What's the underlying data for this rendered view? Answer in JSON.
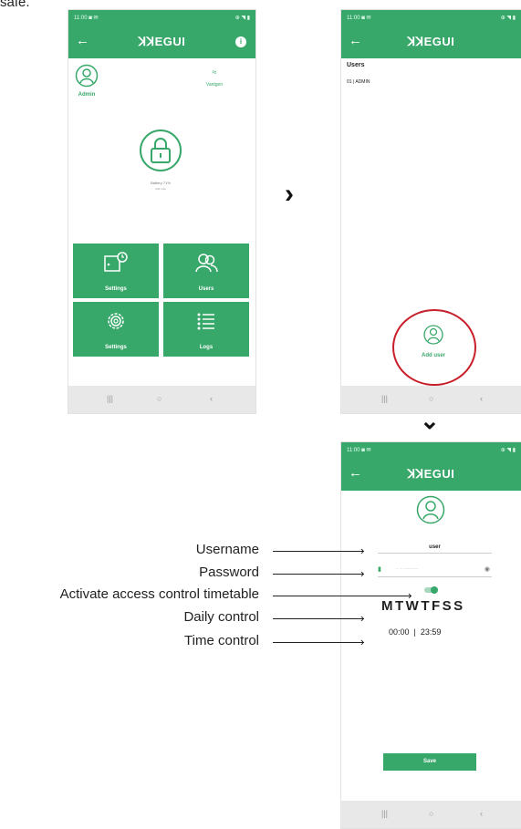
{
  "intro_text": "safe.",
  "colors": {
    "accent": "#38a86a",
    "annotation_circle": "#c8202a"
  },
  "phone1": {
    "status_left": "11:00 ◙ ✉",
    "status_right": "⊕ ◥ ▮",
    "app_title": "ꓘꓘEGUI",
    "info_badge": "i",
    "user_label": "Admin",
    "wifi_label": "Vantgen",
    "lock_caption": "Battery 71%",
    "lock_sub": "Add note",
    "tiles": [
      {
        "label": "Settings",
        "icon": "door-clock-icon"
      },
      {
        "label": "Users",
        "icon": "users-icon"
      },
      {
        "label": "Settings",
        "icon": "gear-icon"
      },
      {
        "label": "Logs",
        "icon": "list-icon"
      }
    ],
    "nav": [
      "|||",
      "○",
      "‹"
    ]
  },
  "phone2": {
    "status_left": "11:00 ◙ ✉",
    "status_right": "⊕ ◥ ▮",
    "app_title": "ꓘꓘEGUI",
    "section_title": "Users",
    "users": [
      "01 | ADMIN"
    ],
    "add_user_label": "Add user",
    "nav": [
      "|||",
      "○",
      "‹"
    ]
  },
  "phone3": {
    "status_left": "11:00 ◙ ✉",
    "status_right": "⊕ ◥ ▮",
    "app_title": "ꓘꓘEGUI",
    "username_value": "user",
    "password_value": "·· ·· ·········",
    "days": "MTWTFSS",
    "time_range": "00:00  |  23:59",
    "save_label": "Save",
    "nav": [
      "|||",
      "○",
      "‹"
    ]
  },
  "flow_arrows": {
    "right": "›",
    "down": "⌄"
  },
  "annotations": [
    "Username",
    "Password",
    "Activate access control timetable",
    "Daily control",
    "Time control"
  ]
}
